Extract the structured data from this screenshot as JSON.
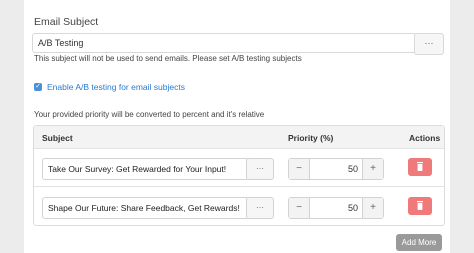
{
  "form": {
    "subject_label": "Email Subject",
    "subject_value": "A/B Testing",
    "subject_more": "···",
    "help_text": "This subject will not be used to send emails. Please set A/B testing subjects",
    "checkbox_label": "Enable A/B testing for email subjects",
    "checkbox_checked": true,
    "priority_note": "Your provided priority will be converted to percent and it's relative"
  },
  "table": {
    "headers": {
      "subject": "Subject",
      "priority": "Priority (%)",
      "actions": "Actions"
    },
    "rows": [
      {
        "subject": "Take Our Survey: Get Rewarded for Your Input!",
        "more": "···",
        "minus": "−",
        "priority": "50",
        "plus": "+"
      },
      {
        "subject": "Shape Our Future: Share Feedback, Get Rewards!",
        "more": "···",
        "minus": "−",
        "priority": "50",
        "plus": "+"
      }
    ]
  },
  "add_more_label": "Add More",
  "colors": {
    "accent": "#4a90d9",
    "danger": "#f07a7a",
    "muted_button": "#9a9a9a"
  },
  "icons": {
    "checkbox": "check-icon",
    "delete": "trash-icon"
  }
}
